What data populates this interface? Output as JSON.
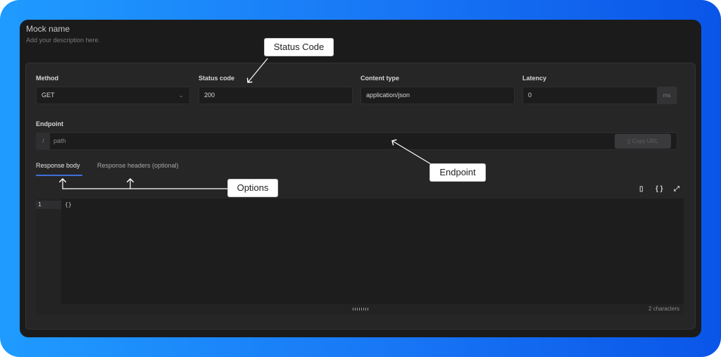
{
  "header": {
    "mock_name": "Mock name",
    "description_placeholder": "Add your description here."
  },
  "fields": {
    "method": {
      "label": "Method",
      "value": "GET",
      "icon": "chevron-down-icon"
    },
    "status_code": {
      "label": "Status code",
      "value": "200"
    },
    "content_type": {
      "label": "Content type",
      "value": "application/json"
    },
    "latency": {
      "label": "Latency",
      "value": "0",
      "suffix": "ms"
    }
  },
  "endpoint": {
    "label": "Endpoint",
    "prefix": "/",
    "placeholder": "path",
    "copy_button": "Copy URL",
    "copy_icon": "copy-icon"
  },
  "tabs": [
    {
      "label": "Response body",
      "active": true
    },
    {
      "label": "Response headers (optional)",
      "active": false
    }
  ],
  "editor_toolbar": {
    "icons": [
      "copy-icon",
      "braces-format-icon",
      "expand-icon"
    ],
    "glyphs": [
      "▯",
      "{ }",
      "⤢"
    ]
  },
  "editor": {
    "line_numbers": [
      "1"
    ],
    "lines": [
      "{}"
    ],
    "char_count": "2 characters"
  },
  "annotations": {
    "status_code": "Status Code",
    "endpoint": "Endpoint",
    "options": "Options"
  },
  "colors": {
    "accent": "#3d6fd6",
    "background_gradient_start": "#1f9bff",
    "background_gradient_end": "#0a55e8"
  }
}
